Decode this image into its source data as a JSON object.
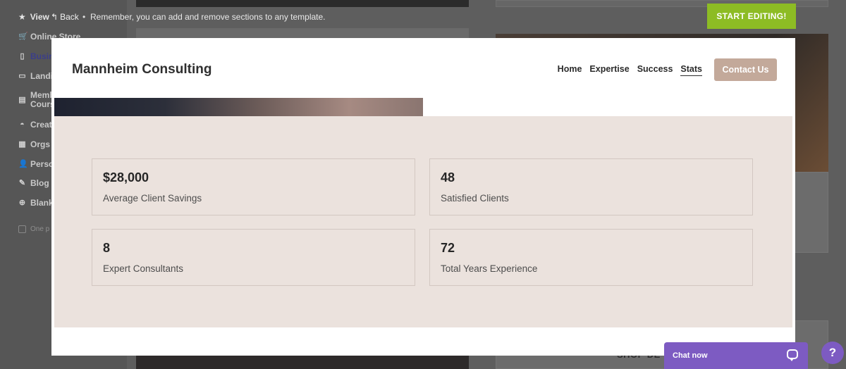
{
  "topbar": {
    "view_label": "View",
    "back_label": "Back",
    "separator": "•",
    "hint": "Remember, you can add and remove sections to any template.",
    "start_editing": "START EDITING!"
  },
  "sidebar": {
    "items": [
      {
        "label": "Online Store",
        "icon": "cart-icon"
      },
      {
        "label": "Busin",
        "icon": "clipboard-icon"
      },
      {
        "label": "Landi",
        "icon": "window-icon"
      },
      {
        "label": "Memb Cours",
        "icon": "id-card-icon"
      },
      {
        "label": "Creat",
        "icon": "palette-icon"
      },
      {
        "label": "Orgs",
        "icon": "building-icon"
      },
      {
        "label": "Perso",
        "icon": "user-icon"
      },
      {
        "label": "Blog",
        "icon": "pen-icon"
      },
      {
        "label": "Blank",
        "icon": "plus-circle-icon"
      }
    ],
    "one_page": "One p"
  },
  "background": {
    "shop_text": "SHOP DE"
  },
  "site": {
    "brand": "Mannheim Consulting",
    "nav": [
      "Home",
      "Expertise",
      "Success",
      "Stats"
    ],
    "active_nav": "Stats",
    "contact_button": "Contact Us"
  },
  "stats": [
    {
      "value": "$28,000",
      "label": "Average Client Savings"
    },
    {
      "value": "48",
      "label": "Satisfied Clients"
    },
    {
      "value": "8",
      "label": "Expert Consultants"
    },
    {
      "value": "72",
      "label": "Total Years Experience"
    }
  ],
  "chat": {
    "label": "Chat now",
    "help_symbol": "?"
  },
  "colors": {
    "start_button": "#8dbc24",
    "contact_button": "#c3a99a",
    "stats_background": "#ebe2dd",
    "chat_widget": "#7d5bc2"
  }
}
